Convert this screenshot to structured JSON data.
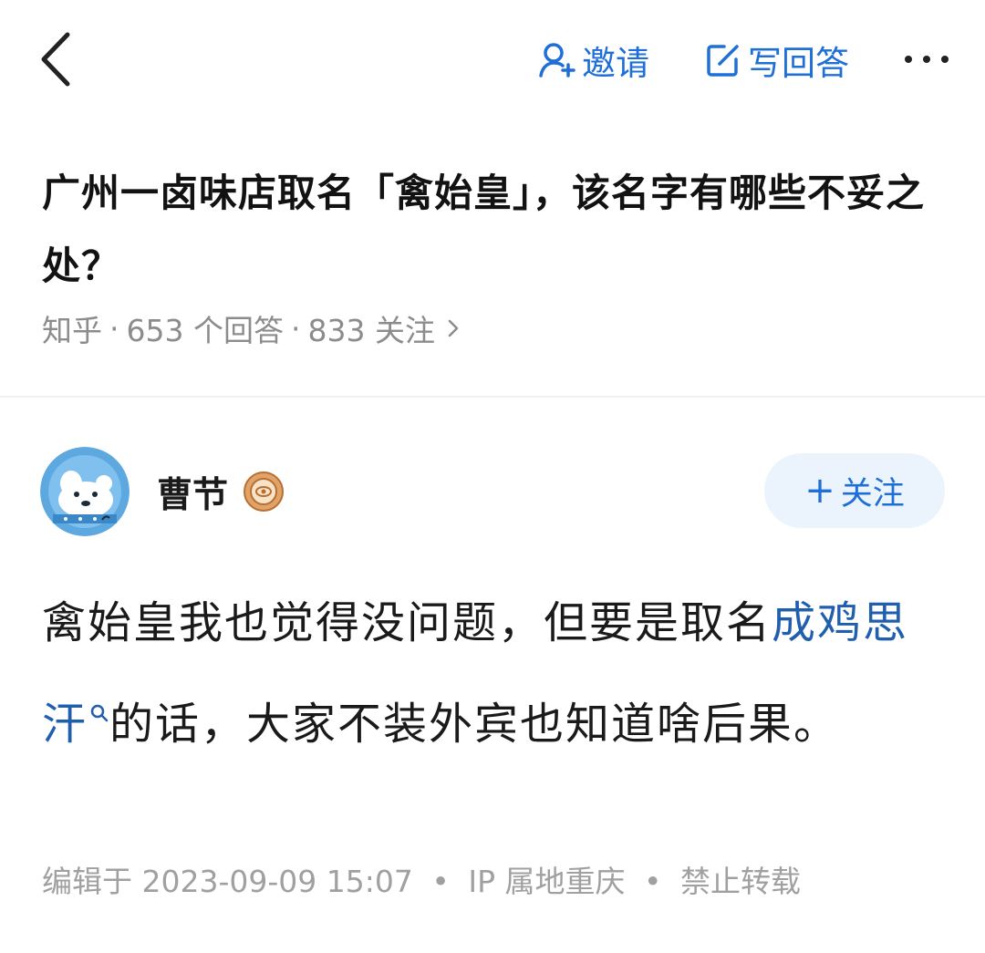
{
  "header": {
    "invite_label": "邀请",
    "write_answer_label": "写回答"
  },
  "question": {
    "title": "广州一卤味店取名「禽始皇」，该名字有哪些不妥之处？",
    "source": "知乎",
    "answer_count": "653 个回答",
    "follow_count": "833 关注"
  },
  "author": {
    "name": "曹节",
    "follow_label": "关注"
  },
  "answer": {
    "text_before": "禽始皇我也觉得没问题，但要是取名",
    "link_text": "成鸡思汗",
    "text_after": "的话，大家不装外宾也知道啥后果。",
    "edited": "编辑于 2023-09-09 15:07",
    "ip_location": "IP 属地重庆",
    "copyright": "禁止转载"
  },
  "colors": {
    "accent": "#1f6fd8",
    "link": "#1f5fae",
    "meta_text": "#8c8c8c",
    "follow_bg": "#ebf3fc"
  }
}
